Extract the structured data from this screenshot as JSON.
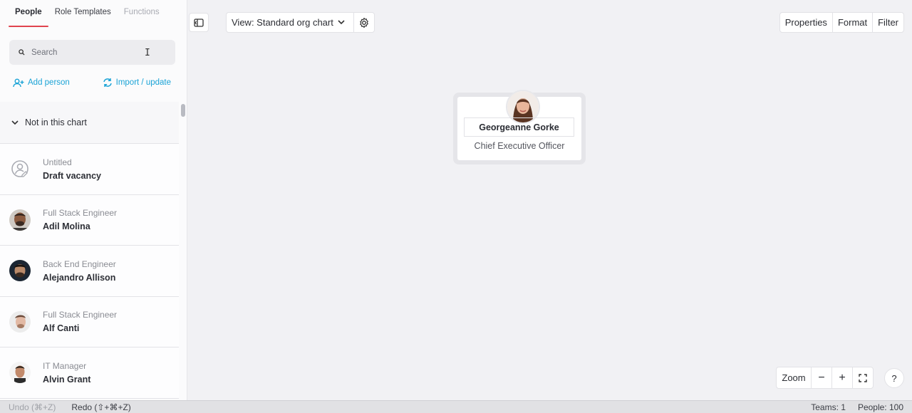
{
  "sidebar": {
    "tabs": [
      {
        "label": "People"
      },
      {
        "label": "Role Templates"
      },
      {
        "label": "Functions"
      }
    ],
    "search": {
      "placeholder": "Search"
    },
    "actions": {
      "add_person": "Add person",
      "import_update": "Import / update"
    },
    "group": {
      "label": "Not in this chart"
    },
    "people": [
      {
        "title": "Untitled",
        "name": "Draft vacancy",
        "icon": "vacancy-icon"
      },
      {
        "title": "Full Stack Engineer",
        "name": "Adil Molina"
      },
      {
        "title": "Back End Engineer",
        "name": "Alejandro Allison"
      },
      {
        "title": "Full Stack Engineer",
        "name": "Alf Canti"
      },
      {
        "title": "IT Manager",
        "name": "Alvin Grant"
      }
    ]
  },
  "toolbar": {
    "view_label": "View: Standard org chart",
    "properties": "Properties",
    "format": "Format",
    "filter": "Filter"
  },
  "chart": {
    "root": {
      "name": "Georgeanne Gorke",
      "role": "Chief Executive Officer"
    }
  },
  "zoom": {
    "label": "Zoom",
    "minus": "−",
    "plus": "+",
    "help": "?"
  },
  "statusbar": {
    "undo": "Undo (⌘+Z)",
    "redo": "Redo (⇧+⌘+Z)",
    "teams": "Teams: 1",
    "people": "People: 100"
  },
  "colors": {
    "accent_tab": "#e0434e",
    "link_blue": "#1aa3d6"
  }
}
